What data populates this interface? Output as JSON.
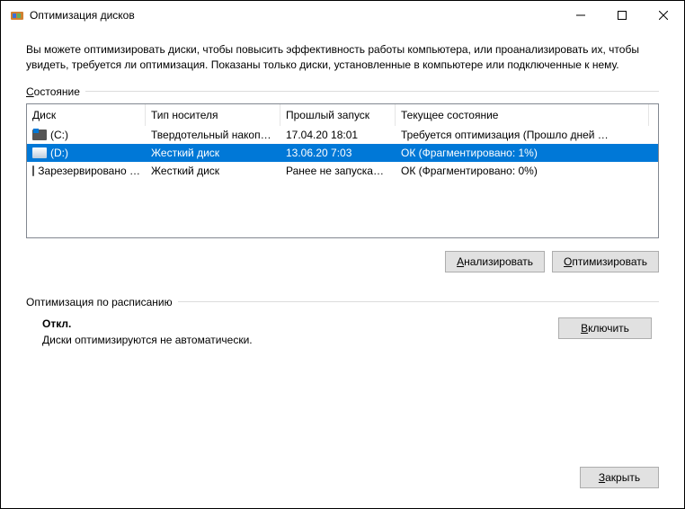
{
  "window": {
    "title": "Оптимизация дисков"
  },
  "description": "Вы можете оптимизировать диски, чтобы повысить эффективность работы  компьютера, или проанализировать их, чтобы увидеть, требуется ли оптимизация. Показаны только диски, установленные в компьютере или подключенные к нему.",
  "state_label_pre": "С",
  "state_label_post": "остояние",
  "columns": {
    "c1": "Диск",
    "c2": "Тип носителя",
    "c3": "Прошлый запуск",
    "c4": "Текущее состояние"
  },
  "rows": [
    {
      "name": "(C:)",
      "media": "Твердотельный накоп…",
      "last": "17.04.20 18:01",
      "status": "Требуется оптимизация (Прошло дней …"
    },
    {
      "name": "(D:)",
      "media": "Жесткий диск",
      "last": "13.06.20 7:03",
      "status": "ОК (Фрагментировано: 1%)"
    },
    {
      "name": "Зарезервировано …",
      "media": "Жесткий диск",
      "last": "Ранее не запуска…",
      "status": "ОК (Фрагментировано: 0%)"
    }
  ],
  "buttons": {
    "analyze_pre": "А",
    "analyze_post": "нализировать",
    "optimize_pre": "О",
    "optimize_post": "птимизировать",
    "enable_pre": "В",
    "enable_post": "ключить",
    "close_pre": "З",
    "close_post": "акрыть"
  },
  "schedule": {
    "heading": "Оптимизация по расписанию",
    "status": "Откл.",
    "detail": "Диски оптимизируются не автоматически."
  }
}
